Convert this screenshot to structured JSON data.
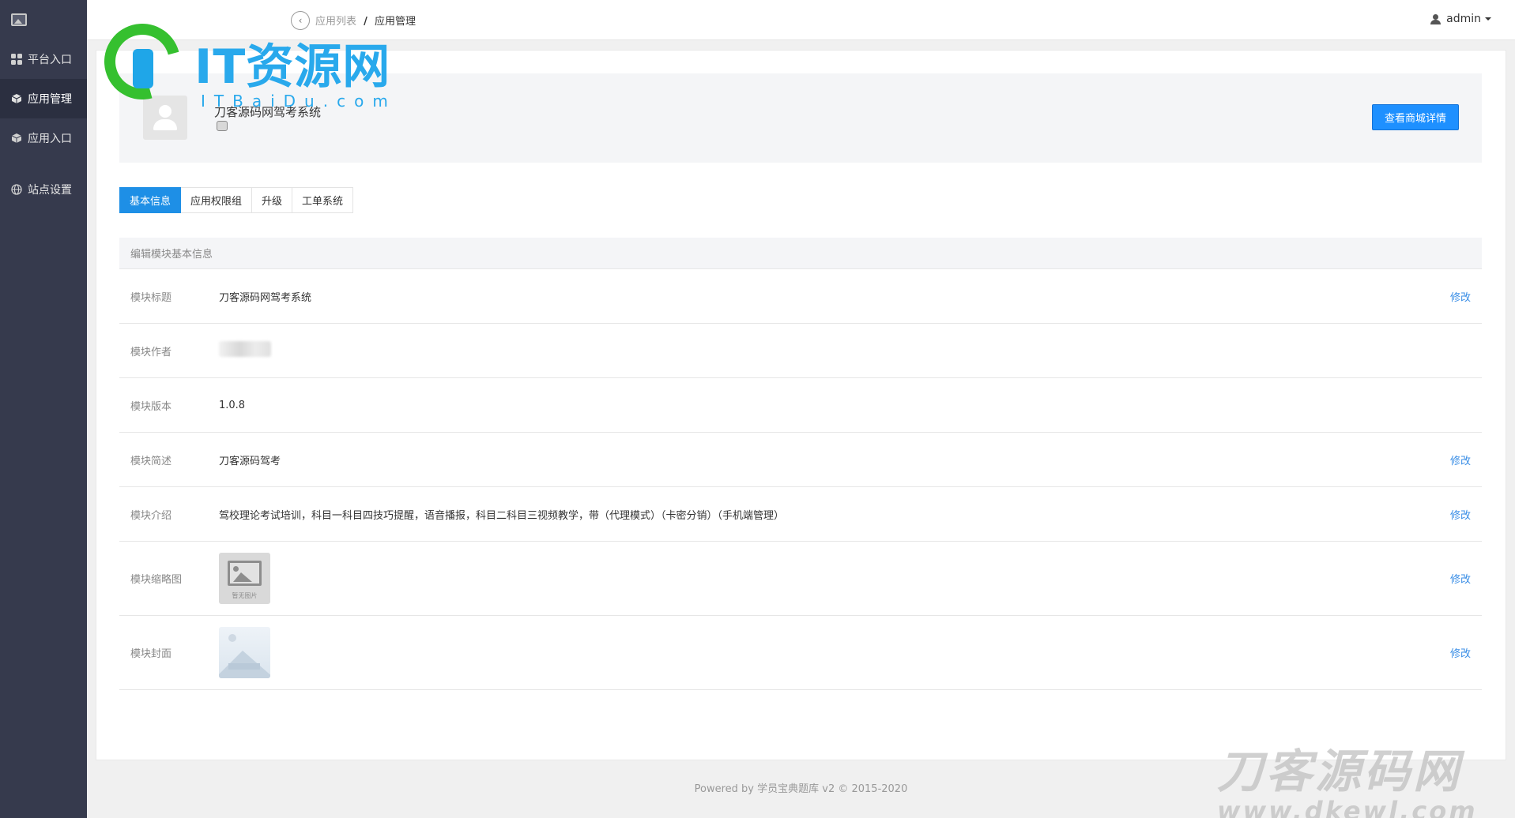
{
  "sidebar": {
    "items": [
      {
        "label": "平台入口",
        "icon": "grid-icon"
      },
      {
        "label": "应用管理",
        "icon": "cube-icon",
        "active": true
      },
      {
        "label": "应用入口",
        "icon": "box-icon"
      },
      {
        "label": "站点设置",
        "icon": "globe-icon"
      }
    ]
  },
  "header": {
    "breadcrumb": {
      "parent": "应用列表",
      "separator": "/",
      "current": "应用管理"
    },
    "user": "admin"
  },
  "app": {
    "name": "刀客源码网驾考系统",
    "shop_button": "查看商城详情"
  },
  "tabs": [
    {
      "label": "基本信息",
      "active": true
    },
    {
      "label": "应用权限组"
    },
    {
      "label": "升级"
    },
    {
      "label": "工单系统"
    }
  ],
  "info": {
    "section_title": "编辑模块基本信息",
    "edit_label": "修改",
    "rows": {
      "title": {
        "label": "模块标题",
        "value": "刀客源码网驾考系统"
      },
      "author": {
        "label": "模块作者"
      },
      "version": {
        "label": "模块版本",
        "value": "1.0.8"
      },
      "summary": {
        "label": "模块简述",
        "value": "刀客源码驾考"
      },
      "intro": {
        "label": "模块介绍",
        "value": "驾校理论考试培训，科目一科目四技巧提醒，语音播报，科目二科目三视频教学，带（代理模式）（卡密分销）（手机端管理）"
      },
      "thumbnail": {
        "label": "模块缩略图",
        "placeholder": "暂无图片"
      },
      "cover": {
        "label": "模块封面"
      }
    }
  },
  "footer": "Powered by 学员宝典题库 v2 © 2015-2020",
  "watermarks": {
    "top_title": "IT资源网",
    "top_sub": "ITBaiDu.com",
    "bottom_title": "刀客源码网",
    "bottom_sub": "www.dkewl.com"
  },
  "colors": {
    "sidebar_bg": "#363a4d",
    "accent": "#1e8fe6",
    "link": "#3a8ee6"
  }
}
